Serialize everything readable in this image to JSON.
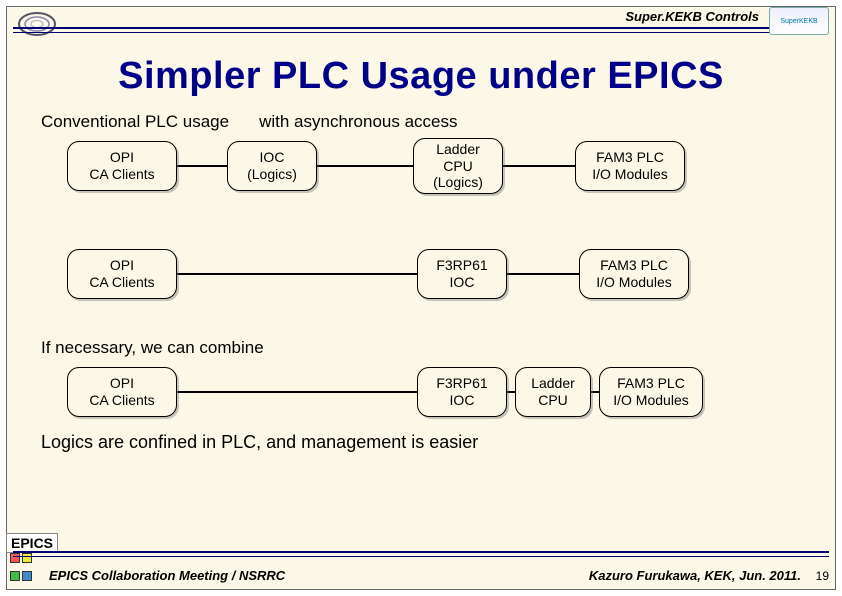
{
  "header": {
    "lab_label": "Super.KEKB Controls",
    "right_badge": "SuperKEKB"
  },
  "title": "Simpler PLC Usage under EPICS",
  "section1": {
    "heading": "Conventional PLC usage",
    "sub": "with asynchronous access"
  },
  "row1": {
    "b1": "OPI\nCA Clients",
    "b2": "IOC\n(Logics)",
    "b3": "Ladder\nCPU\n(Logics)",
    "b4": "FAM3 PLC\nI/O Modules"
  },
  "row2": {
    "b1": "OPI\nCA Clients",
    "b3": "F3RP61\nIOC",
    "b4": "FAM3 PLC\nI/O Modules"
  },
  "section2": {
    "heading": "If necessary, we can combine"
  },
  "row3": {
    "b1": "OPI\nCA Clients",
    "b3": "F3RP61\nIOC",
    "b3b": "Ladder\nCPU",
    "b4": "FAM3 PLC\nI/O Modules"
  },
  "summary": "Logics are confined in PLC, and management is easier",
  "footer": {
    "badge": "EPICS",
    "meeting": "EPICS Collaboration Meeting / NSRRC",
    "author": "Kazuro Furukawa, KEK, Jun. 2011.",
    "page": "19"
  }
}
